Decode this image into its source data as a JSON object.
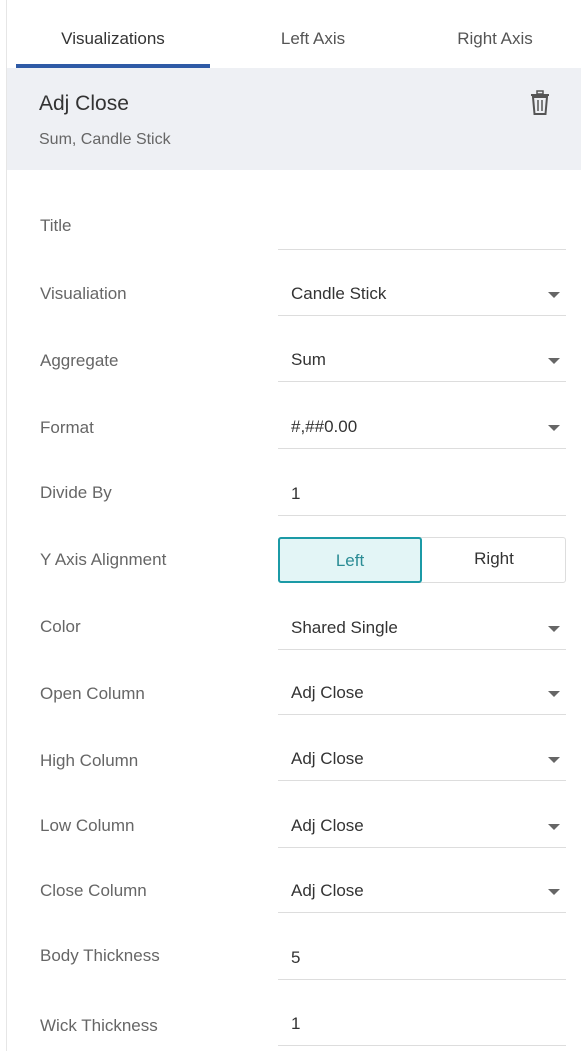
{
  "tabs": [
    {
      "label": "Visualizations"
    },
    {
      "label": "Left Axis"
    },
    {
      "label": "Right Axis"
    }
  ],
  "header": {
    "title": "Adj Close",
    "subtitle": "Sum, Candle Stick"
  },
  "fields": {
    "title": {
      "label": "Title",
      "value": ""
    },
    "visualization": {
      "label": "Visualiation",
      "value": "Candle Stick"
    },
    "aggregate": {
      "label": "Aggregate",
      "value": "Sum"
    },
    "format": {
      "label": "Format",
      "value": "#,##0.00"
    },
    "divide_by": {
      "label": "Divide By",
      "value": "1"
    },
    "y_axis_alignment": {
      "label": "Y Axis Alignment",
      "options": [
        "Left",
        "Right"
      ],
      "selected": "Left"
    },
    "color": {
      "label": "Color",
      "value": "Shared Single"
    },
    "open_column": {
      "label": "Open Column",
      "value": "Adj Close"
    },
    "high_column": {
      "label": "High Column",
      "value": "Adj Close"
    },
    "low_column": {
      "label": "Low Column",
      "value": "Adj Close"
    },
    "close_column": {
      "label": "Close Column",
      "value": "Adj Close"
    },
    "body_thickness": {
      "label": "Body Thickness",
      "value": "5"
    },
    "wick_thickness": {
      "label": "Wick Thickness",
      "value": "1"
    }
  },
  "colors": {
    "accent_tab": "#2e5aa6",
    "toggle_selected_border": "#1b9aa6",
    "toggle_selected_bg": "#e3f5f6",
    "header_bg": "#eef0f4"
  },
  "icons": {
    "delete": "trash-icon",
    "dropdown": "chevron-down-icon"
  }
}
